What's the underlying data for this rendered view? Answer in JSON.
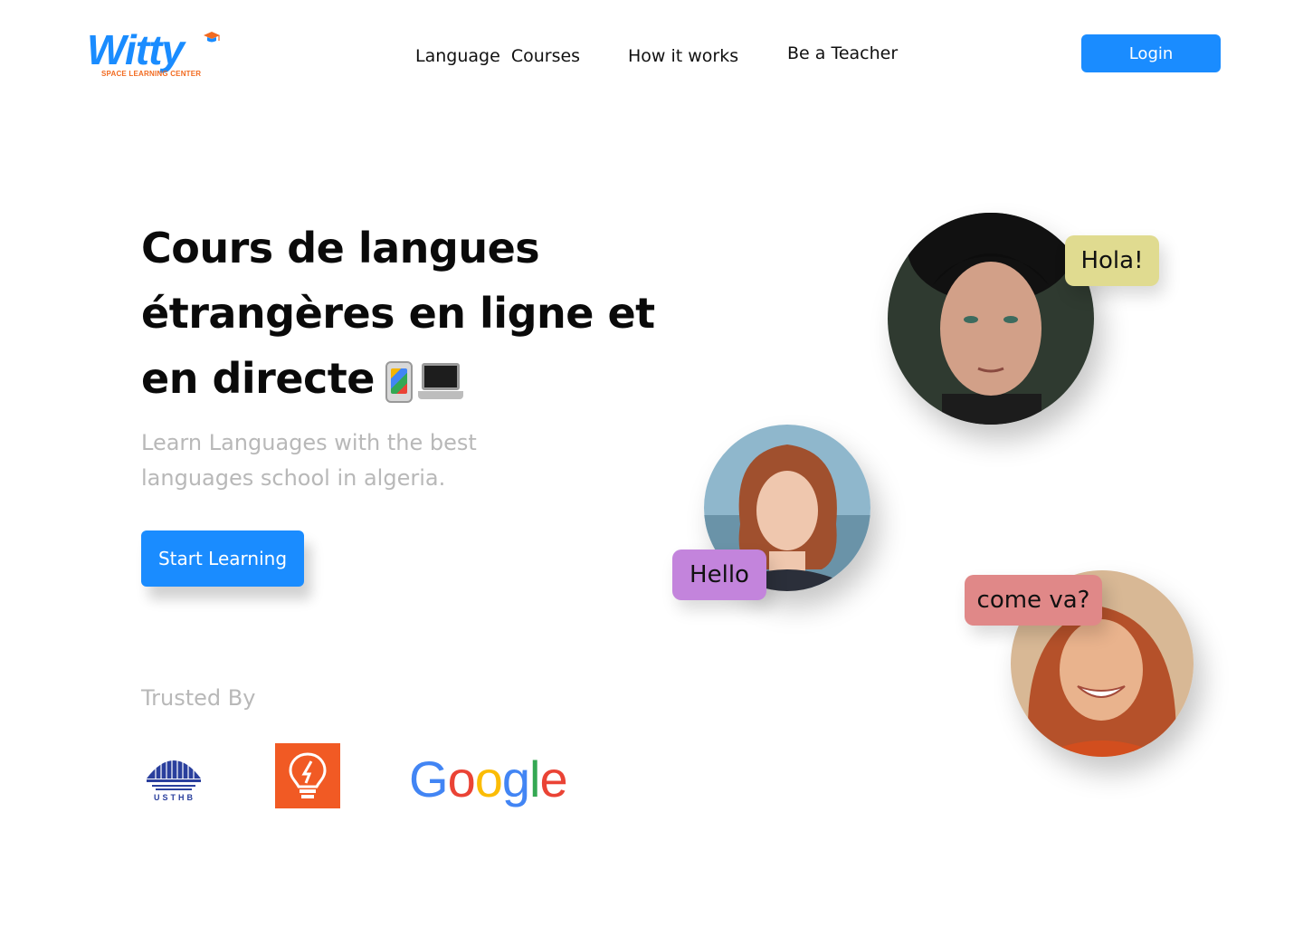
{
  "header": {
    "logo_text": "Witty",
    "logo_tagline": "SPACE LEARNING CENTER",
    "nav": {
      "language_courses": "Language  Courses",
      "how_it_works": "How it works",
      "be_a_teacher": "Be a Teacher"
    },
    "login_label": "Login"
  },
  "hero": {
    "title": "Cours de langues étrangères en ligne et en directe",
    "title_icons": [
      "mobile-phone-icon",
      "laptop-icon"
    ],
    "subtitle": "Learn Languages with the best languages school in algeria.",
    "cta_label": "Start Learning"
  },
  "trusted": {
    "label": "Trusted By",
    "logos": [
      {
        "name": "usthb-logo",
        "text": "USTHB"
      },
      {
        "name": "lightbulb-logo"
      },
      {
        "name": "google-logo",
        "text": "Google"
      }
    ]
  },
  "speech_bubbles": {
    "hola": "Hola!",
    "hello": "Hello",
    "come_va": "come va?"
  },
  "colors": {
    "primary": "#1a8cff",
    "accent_orange": "#f26b21",
    "muted_text": "#b8b8b8",
    "bubble_hola": "#e0db90",
    "bubble_hello": "#c384dc",
    "bubble_come_va": "#e08888"
  }
}
